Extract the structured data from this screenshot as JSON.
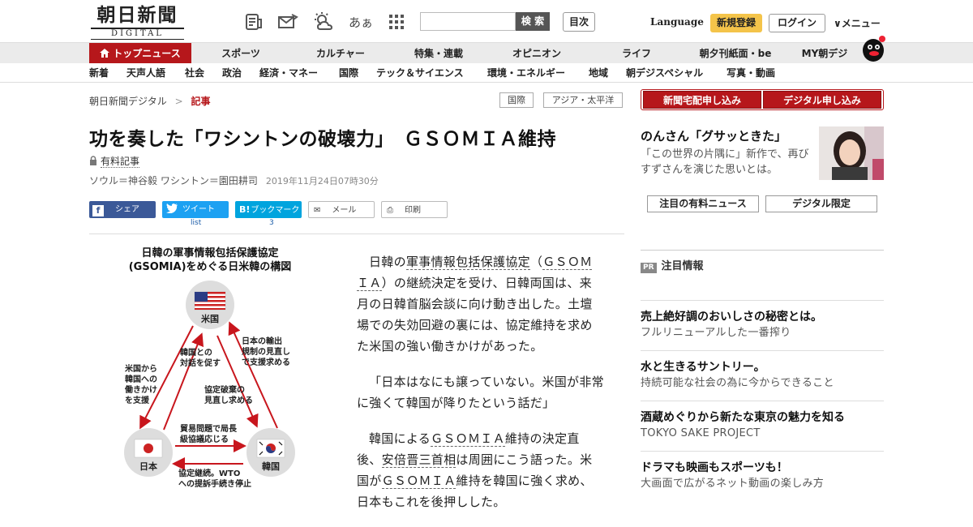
{
  "header": {
    "logo_main": "朝日新聞",
    "logo_sub": "DIGITAL",
    "search_button": "検 索",
    "mokuji": "目次",
    "language": "Language",
    "signup": "新規登録",
    "login": "ログイン",
    "menu": "∨メニュー",
    "kana_icon": "あぁ"
  },
  "nav_primary": [
    "トップニュース",
    "スポーツ",
    "カルチャー",
    "特集・連載",
    "オピニオン",
    "ライフ",
    "朝夕刊紙面・be",
    "MY朝デジ"
  ],
  "nav_secondary": [
    "新着",
    "天声人語",
    "社会",
    "政治",
    "経済・マネー",
    "国際",
    "テック＆サイエンス",
    "環境・エネルギー",
    "地域",
    "朝デジスペシャル",
    "写真・動画"
  ],
  "breadcrumb": {
    "home": "朝日新聞デジタル",
    "sep": ">",
    "current": "記事"
  },
  "tags": [
    "国際",
    "アジア・太平洋"
  ],
  "article": {
    "title": "功を奏した「ワシントンの破壊力」　ＧＳＯＭＩＡ維持",
    "paid_label": "有料記事",
    "byline": "ソウル＝神谷毅 ワシントン＝園田耕司",
    "date": "2019年11月24日07時30分",
    "share": {
      "facebook": "シェア",
      "tweet": "ツイート",
      "bookmark": "ブックマーク",
      "mail": "メール",
      "print": "印刷",
      "tweet_sub": "list",
      "bookmark_sub": "3",
      "hatena_logo": "B!"
    },
    "p1_a": "日韓の",
    "p1_link": "軍事情報包括保護協定",
    "p1_b": "（",
    "p1_link2": "ＧＳＯＭＩＡ",
    "p1_c": "）の継続決定を受け、日韓両国は、来月の日韓首脳会談に向け動き出した。土壇場での失効回避の裏には、協定維持を求めた米国の強い働きかけがあった。",
    "p2": "「日本はなにも譲っていない。米国が非常に強くて韓国が降りたという話だ」",
    "p3_a": "韓国による",
    "p3_link": "ＧＳＯＭＩＡ",
    "p3_b": "維持の決定直後、",
    "p3_link2": "安倍晋三首相",
    "p3_c": "は周囲にこう語った。米国が",
    "p3_link3": "ＧＳＯＭＩＡ",
    "p3_d": "維持を韓国に強く求め、日本もこれを後押しした。"
  },
  "figure": {
    "title1": "日韓の軍事情報包括保護協定",
    "title2": "(GSOMIA)をめぐる日米韓の構図",
    "us": "米国",
    "japan": "日本",
    "korea": "韓国",
    "l_us_kr_1": "韓国との",
    "l_us_kr_2": "対話を促す",
    "l_jp_us_1": "日本の輸出",
    "l_jp_us_2": "規制の見直し",
    "l_jp_us_3": "で支援求める",
    "l_us_left_1": "米国から",
    "l_us_left_2": "韓国への",
    "l_us_left_3": "働きかけ",
    "l_us_left_4": "を支援",
    "l_kr_1": "協定破棄の",
    "l_kr_2": "見直し求める",
    "l_trade_1": "貿易問題で局長",
    "l_trade_2": "級協議応じる",
    "l_wto_1": "協定継続。WTO",
    "l_wto_2": "への提訴手続き停止"
  },
  "sidebar": {
    "btn_paper": "新聞宅配申し込み",
    "btn_digital": "デジタル申し込み",
    "promo_title": "のんさん「グサッときた」",
    "promo_text": "「この世界の片隅に」新作で、再びすずさんを演じた思いとは。",
    "btn_news": "注目の有料ニュース",
    "btn_limited": "デジタル限定",
    "pr_badge": "PR",
    "pr_heading": "注目情報",
    "ads": [
      {
        "title": "売上絶好調のおいしさの秘密とは。",
        "sub": "フルリニューアルした一番搾り"
      },
      {
        "title": "水と生きるサントリー。",
        "sub": "持続可能な社会の為に今からできること"
      },
      {
        "title": "酒蔵めぐりから新たな東京の魅力を知る",
        "sub": "TOKYO SAKE PROJECT"
      },
      {
        "title": "ドラマも映画もスポーツも！",
        "sub": "大画面で広がるネット動画の楽しみ方"
      }
    ]
  }
}
